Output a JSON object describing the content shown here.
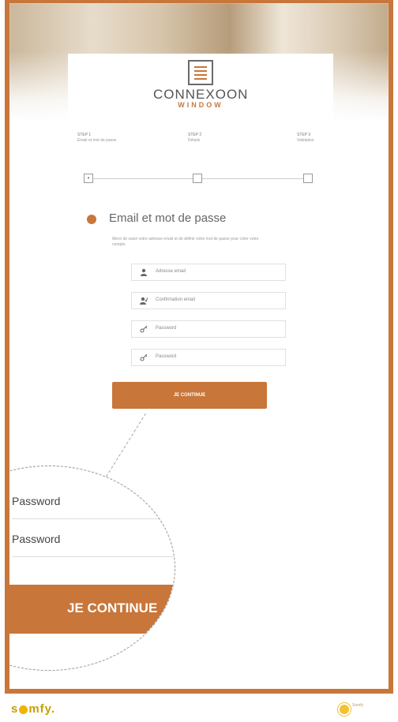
{
  "brand": {
    "title": "CONNEXOON",
    "subtitle": "WINDOW"
  },
  "steps": [
    {
      "num": "STEP 1",
      "label": "Email et mot de passe",
      "box": "•"
    },
    {
      "num": "STEP 2",
      "label": "Détails",
      "box": ""
    },
    {
      "num": "STEP 3",
      "label": "Validation",
      "box": ""
    }
  ],
  "section": {
    "title": "Email et mot de passe",
    "description": "Merci de saisir votre adresse email et de définir votre mot de passe pour créer votre compte."
  },
  "fields": [
    {
      "placeholder": "Adresse email",
      "icon": "user-icon"
    },
    {
      "placeholder": "Confirmation email",
      "icon": "user-check-icon"
    },
    {
      "placeholder": "Password",
      "icon": "key-icon"
    },
    {
      "placeholder": "Password",
      "icon": "key-icon"
    }
  ],
  "buttons": {
    "continue": "JE CONTINUE"
  },
  "zoom": {
    "field1": "Password",
    "field2": "Password",
    "button": "JE CONTINUE"
  },
  "footer": {
    "logo": "somfy",
    "tagline": "Somfy"
  },
  "colors": {
    "accent": "#c8763a",
    "text": "#666666",
    "footer_logo": "#c8a000"
  }
}
